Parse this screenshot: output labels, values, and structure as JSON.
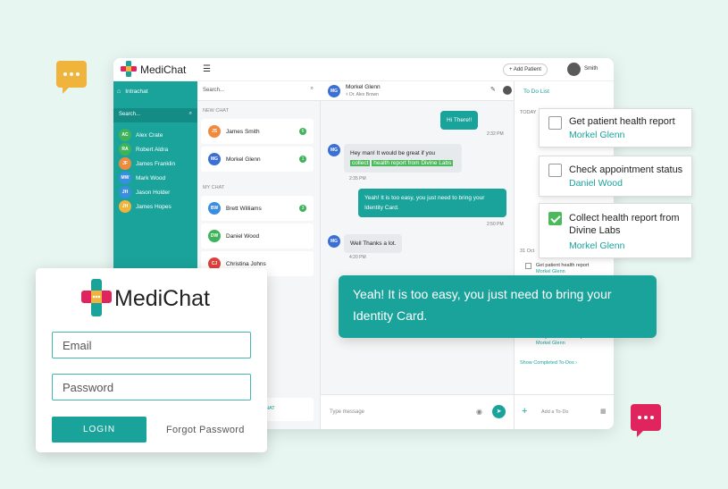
{
  "colors": {
    "accent": "#1aa39b",
    "yellow": "#f0b43c",
    "pink": "#e0245e",
    "green": "#4cba5c"
  },
  "topbar": {
    "brand": "MediChat",
    "add_patient": "+ Add Patient",
    "user": "Smith"
  },
  "sidebar": {
    "intrachat": "Intrachat",
    "search_placeholder": "Search...",
    "items": [
      {
        "initials": "AC",
        "name": "Alex Crate",
        "color": "#3fb35a"
      },
      {
        "initials": "RA",
        "name": "Robert Aldra",
        "color": "#3fb35a"
      },
      {
        "initials": "JF",
        "name": "James Franklin",
        "color": "#f08a3c"
      },
      {
        "initials": "MW",
        "name": "Mark Wood",
        "color": "#3a8ee0"
      },
      {
        "initials": "JH",
        "name": "Jason Holder",
        "color": "#3a8ee0"
      },
      {
        "initials": "JH",
        "name": "James Hopes",
        "color": "#f0b43c"
      }
    ]
  },
  "contacts": {
    "search_placeholder": "Search...",
    "new_chat_label": "NEW CHAT",
    "my_chat_label": "MY CHAT",
    "new_chats": [
      {
        "initials": "JS",
        "name": "James Smith",
        "badge": "6",
        "color": "#f08a3c"
      },
      {
        "initials": "MG",
        "name": "Morkel Glenn",
        "badge": "1",
        "color": "#3a6fd6"
      }
    ],
    "my_chats": [
      {
        "initials": "BW",
        "name": "Brett Williams",
        "badge": "3",
        "color": "#3a8ee0"
      },
      {
        "initials": "DW",
        "name": "Daniel Wood",
        "badge": "",
        "color": "#3fb35a"
      },
      {
        "initials": "CJ",
        "name": "Christina Johns",
        "badge": "",
        "color": "#e0403c"
      }
    ],
    "footer_label": "HAT"
  },
  "chat": {
    "contact_name": "Morkel Glenn",
    "contact_initials": "MG",
    "doctor": "Dr. Alex Brown",
    "messages": [
      {
        "text": "Hi There!!",
        "time": "2:32 PM"
      },
      {
        "text_a": "Hey man! It would be great if you ",
        "text_hl1": "collect",
        "text_hl2": "health report from Divine Labs",
        "time": "2:35 PM"
      },
      {
        "text": "Yeah! It is too easy, you just need to bring your Identity Card.",
        "time": "2:50 PM"
      },
      {
        "text": "Well Thanks a lot.",
        "time": "4:20 PM"
      }
    ],
    "input_placeholder": "Type message"
  },
  "todo": {
    "title": "To Do List",
    "today": "TODAY",
    "date2": "31 Oct",
    "small_items": [
      {
        "title": "Get patient health report",
        "sub": "Morkel Glenn"
      },
      {
        "title": "Get patient health report",
        "sub": "Morkel Glenn"
      }
    ],
    "show_completed": "Show Completed To-Dos",
    "add_placeholder": "Add a To-Do"
  },
  "floating_todos": [
    {
      "title": "Get patient health report",
      "sub": "Morkel Glenn",
      "checked": false
    },
    {
      "title": "Check appointment status",
      "sub": "Daniel Wood",
      "checked": false
    },
    {
      "title": "Collect health report from Divine Labs",
      "sub": "Morkel Glenn",
      "checked": true
    }
  ],
  "big_message": "Yeah! It is too easy, you just need to bring your Identity Card.",
  "login": {
    "brand": "MediChat",
    "email_placeholder": "Email",
    "password_placeholder": "Password",
    "login_button": "LOGIN",
    "forgot": "Forgot Password"
  }
}
